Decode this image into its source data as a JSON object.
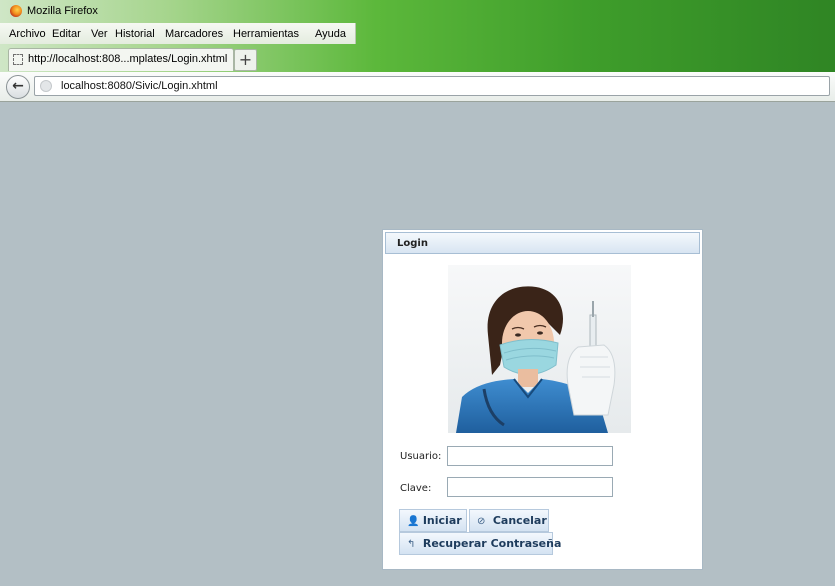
{
  "window": {
    "title": "Mozilla Firefox"
  },
  "menu": [
    {
      "label": "Archivo"
    },
    {
      "label": "Editar"
    },
    {
      "label": "Ver"
    },
    {
      "label": "Historial"
    },
    {
      "label": "Marcadores"
    },
    {
      "label": "Herramientas"
    },
    {
      "label": "Ayuda"
    }
  ],
  "tab": {
    "title": "http://localhost:808...mplates/Login.xhtml",
    "new_tab": "+"
  },
  "nav": {
    "back": "←",
    "url": "localhost:8080/Sivic/Login.xhtml"
  },
  "login": {
    "title": "Login",
    "usuario_label": "Usuario:",
    "usuario_value": "",
    "clave_label": "Clave:",
    "clave_value": "",
    "iniciar": "Iniciar",
    "cancelar": "Cancelar",
    "recuperar": "Recuperar Contraseña"
  },
  "icons": {
    "iniciar": "user-icon",
    "cancelar": "cancel-icon",
    "recuperar": "recover-icon"
  },
  "colors": {
    "page_background": "#b3bfc5",
    "button_text": "#1d3b5c",
    "scrub_blue": "#2a73b8",
    "mask": "#9ad7e0"
  }
}
